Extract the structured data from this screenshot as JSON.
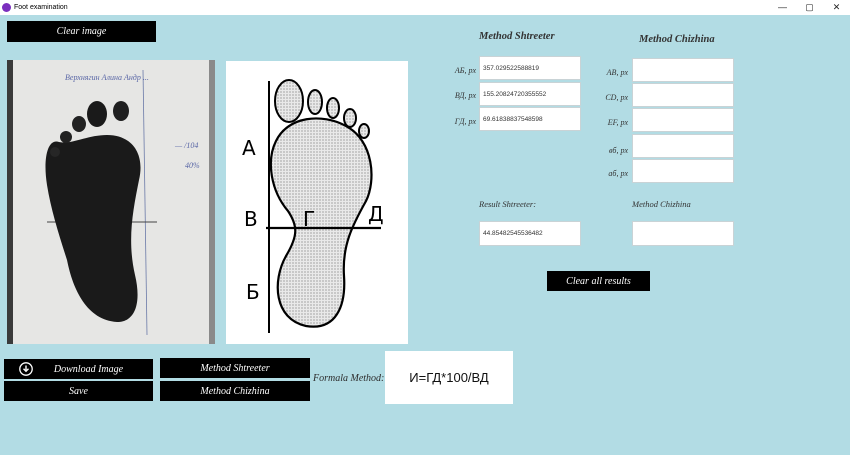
{
  "window": {
    "title": "Foot examination",
    "controls": [
      "—",
      "▢",
      "✕"
    ]
  },
  "buttons": {
    "clear_image": "Clear image",
    "download_image": "Download Image",
    "save": "Save",
    "method_shtreeter": "Method Shtreeter",
    "method_chizhina": "Method Chizhina",
    "clear_all_results": "Clear all results"
  },
  "diagram": {
    "labels": [
      "А",
      "В",
      "Г",
      "Д",
      "Б"
    ]
  },
  "photo": {
    "annotation": "Верхнягин Алина Андр ..."
  },
  "shtreeter": {
    "title": "Method Shtreeter",
    "fields": [
      {
        "label": "АБ, px",
        "value": "357.029522588819"
      },
      {
        "label": "ВД, px",
        "value": "155.20824720355552"
      },
      {
        "label": "ГД, px",
        "value": "69.61838837548598"
      }
    ],
    "result_label": "Result Shtreeter:",
    "result_value": "44.85482545536482"
  },
  "chizhina": {
    "title": "Method Chizhina",
    "fields": [
      {
        "label": "AB, px",
        "value": ""
      },
      {
        "label": "CD, px",
        "value": ""
      },
      {
        "label": "EF, px",
        "value": ""
      },
      {
        "label": "вб, px",
        "value": ""
      },
      {
        "label": "аб, px",
        "value": ""
      }
    ],
    "result_label": "Method Chizhina",
    "result_value": ""
  },
  "formula": {
    "label": "Formala Method:",
    "value": "И=ГД*100/ВД"
  },
  "colors": {
    "background": "#b2dce4",
    "button": "#000000"
  }
}
